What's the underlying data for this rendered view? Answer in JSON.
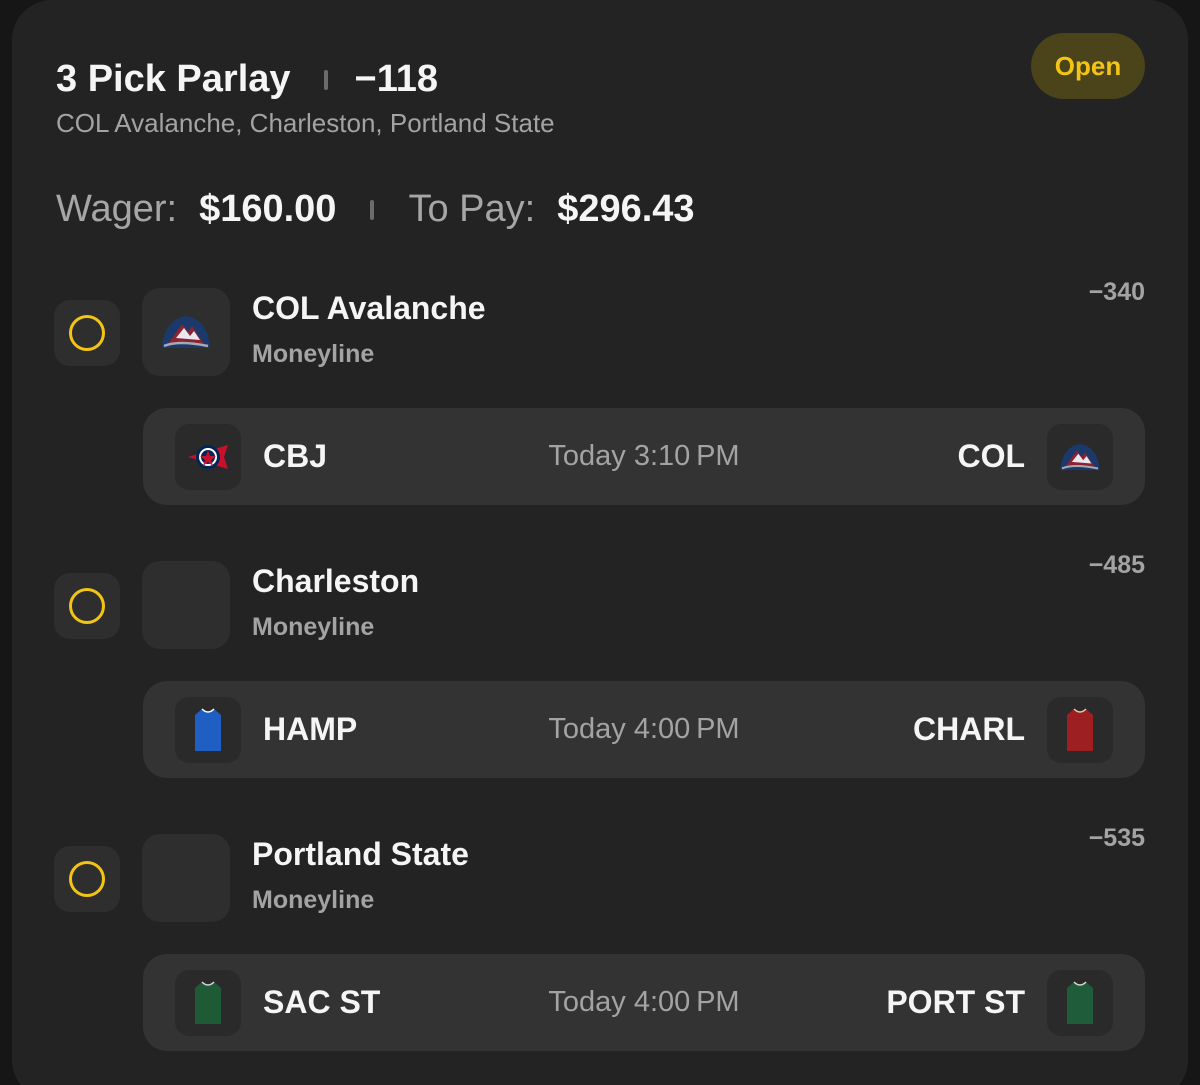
{
  "bet": {
    "title": "3 Pick Parlay",
    "odds": "−118",
    "subtitle": "COL Avalanche, Charleston, Portland State",
    "status": "Open",
    "wager_label": "Wager:",
    "wager_value": "$160.00",
    "to_pay_label": "To Pay:",
    "to_pay_value": "$296.43"
  },
  "colors": {
    "card": "#232323",
    "accent_yellow": "#f2c415",
    "badge_bg": "#4b4319",
    "matchup_bg": "#333333",
    "muted_text": "#a3a3a3"
  },
  "picks": [
    {
      "name": "COL Avalanche",
      "market": "Moneyline",
      "odds": "−340",
      "logo_icon": "avalanche-logo-icon",
      "game": {
        "away": "CBJ",
        "away_icon": "blue-jackets-logo-icon",
        "time": "Today 3:10 PM",
        "home": "COL",
        "home_icon": "avalanche-logo-icon"
      }
    },
    {
      "name": "Charleston",
      "market": "Moneyline",
      "odds": "−485",
      "logo_icon": "blank-logo-icon",
      "game": {
        "away": "HAMP",
        "away_icon": "blue-jersey-icon",
        "time": "Today 4:00 PM",
        "home": "CHARL",
        "home_icon": "red-jersey-icon"
      }
    },
    {
      "name": "Portland State",
      "market": "Moneyline",
      "odds": "−535",
      "logo_icon": "blank-logo-icon",
      "game": {
        "away": "SAC ST",
        "away_icon": "green-jersey-icon",
        "time": "Today 4:00 PM",
        "home": "PORT ST",
        "home_icon": "green-jersey-icon"
      }
    }
  ]
}
